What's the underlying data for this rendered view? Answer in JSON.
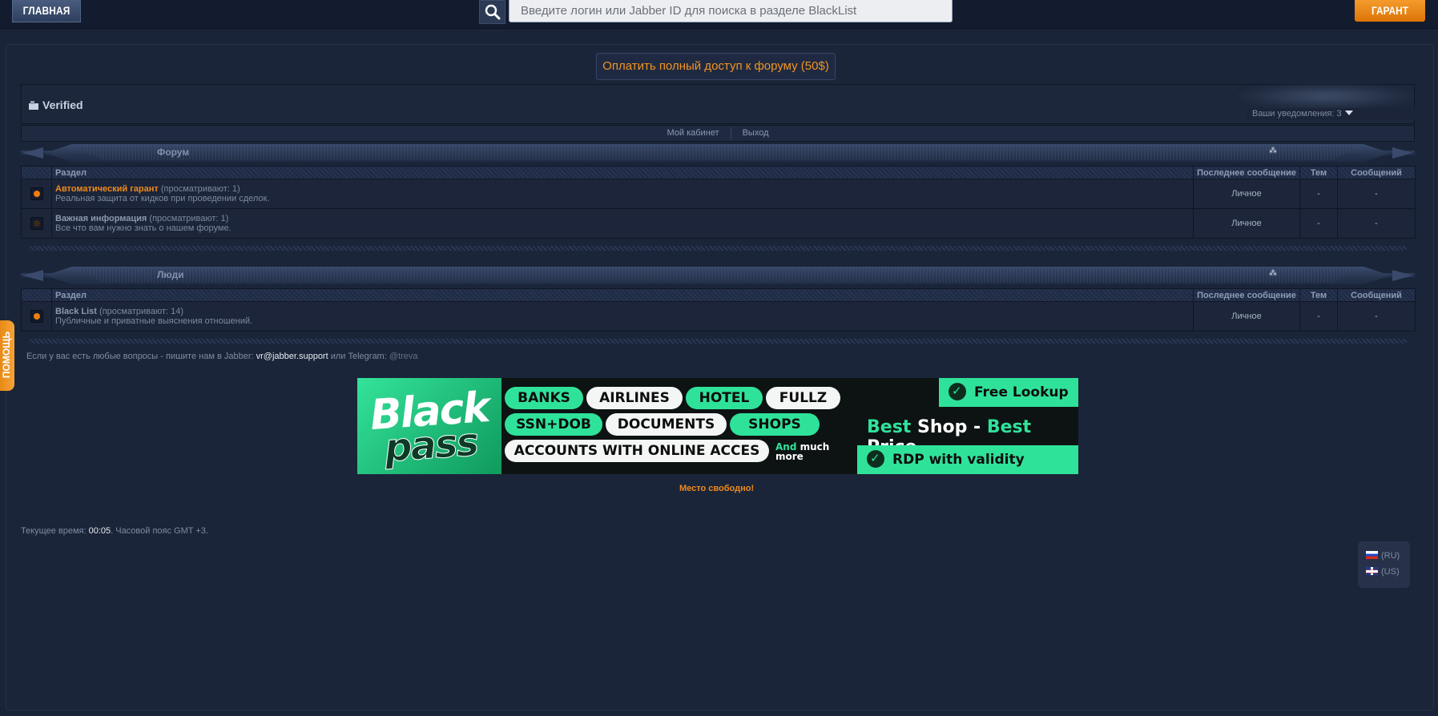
{
  "topbar": {
    "home_label": "ГЛАВНАЯ",
    "search_placeholder": "Введите логин или Jabber ID для поиска в разделе BlackList",
    "garant_label": "ГАРАНТ"
  },
  "pay_button": "Оплатить полный доступ к форуму (50$)",
  "user": {
    "group": "Verified",
    "notifications": "Ваши уведомления: 3"
  },
  "subnav": {
    "cabinet": "Мой кабинет",
    "logout": "Выход"
  },
  "sections": [
    {
      "title": "Форум",
      "headers": [
        "Раздел",
        "Последнее сообщение",
        "Тем",
        "Сообщений"
      ],
      "rows": [
        {
          "name": "Автоматический гарант",
          "views": "(просматривают: 1)",
          "desc": "Реальная защита от кидков при проведении сделок.",
          "last": "Личное",
          "topics": "-",
          "posts": "-",
          "status_color": "#f07c0f"
        },
        {
          "name": "Важная информация",
          "views": "(просматривают: 1)",
          "desc": "Все что вам нужно знать о нашем форуме.",
          "last": "Личное",
          "topics": "-",
          "posts": "-",
          "status_color": "#3a2a1a"
        }
      ]
    },
    {
      "title": "Люди",
      "headers": [
        "Раздел",
        "Последнее сообщение",
        "Тем",
        "Сообщений"
      ],
      "rows": [
        {
          "name": "Black List",
          "views": "(просматривают: 14)",
          "desc": "Публичные и приватные выяснения отношений.",
          "last": "Личное",
          "topics": "-",
          "posts": "-",
          "status_color": "#f07c0f"
        }
      ]
    }
  ],
  "contact": {
    "prefix": "Если у вас есть любые вопросы - пишите нам в Jabber:",
    "jabber": "vr@jabber.support",
    "middle": "или Telegram:",
    "telegram": "@treva"
  },
  "help_tab": "ПОМОЩЬ",
  "ad": {
    "logo_top": "Black",
    "logo_bottom": "pass",
    "pills": [
      "BANKS",
      "AIRLINES",
      "HOTEL",
      "FULLZ",
      "SSN+DOB",
      "DOCUMENTS",
      "SHOPS",
      "ACCOUNTS WITH ONLINE ACCES"
    ],
    "more_1": "And",
    "more_2": "much",
    "more_3": "more",
    "free_lookup": "Free Lookup",
    "best_1": "Best",
    "shop": "Shop -",
    "best_2": "Best",
    "price": "Price",
    "rdp": "RDP with validity checker"
  },
  "free_place": "Место свободно!",
  "time": {
    "prefix": "Текущее время:",
    "value": "00:05",
    "suffix": ". Часовой пояс GMT +3."
  },
  "lang": {
    "ru": "(RU)",
    "us": "(US)"
  },
  "colors": {
    "accent_orange": "#f08a1c",
    "ad_green": "#2fe29a",
    "background": "#1a2438"
  }
}
